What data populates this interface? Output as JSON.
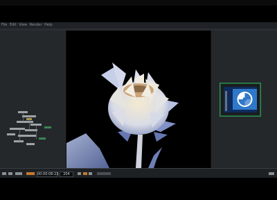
{
  "menubar": {
    "items": [
      "File",
      "Edit",
      "View",
      "Render",
      "Help"
    ]
  },
  "timeline": {
    "timecode": "00:00:08:23",
    "frame": "204"
  },
  "colors": {
    "panel": "#25282b",
    "accent_green": "#2f8f53",
    "accent_orange": "#c67a2b",
    "thumb_blue": "#2f78c9"
  },
  "icons": {
    "thumbnail": "swirl-logo-icon"
  }
}
